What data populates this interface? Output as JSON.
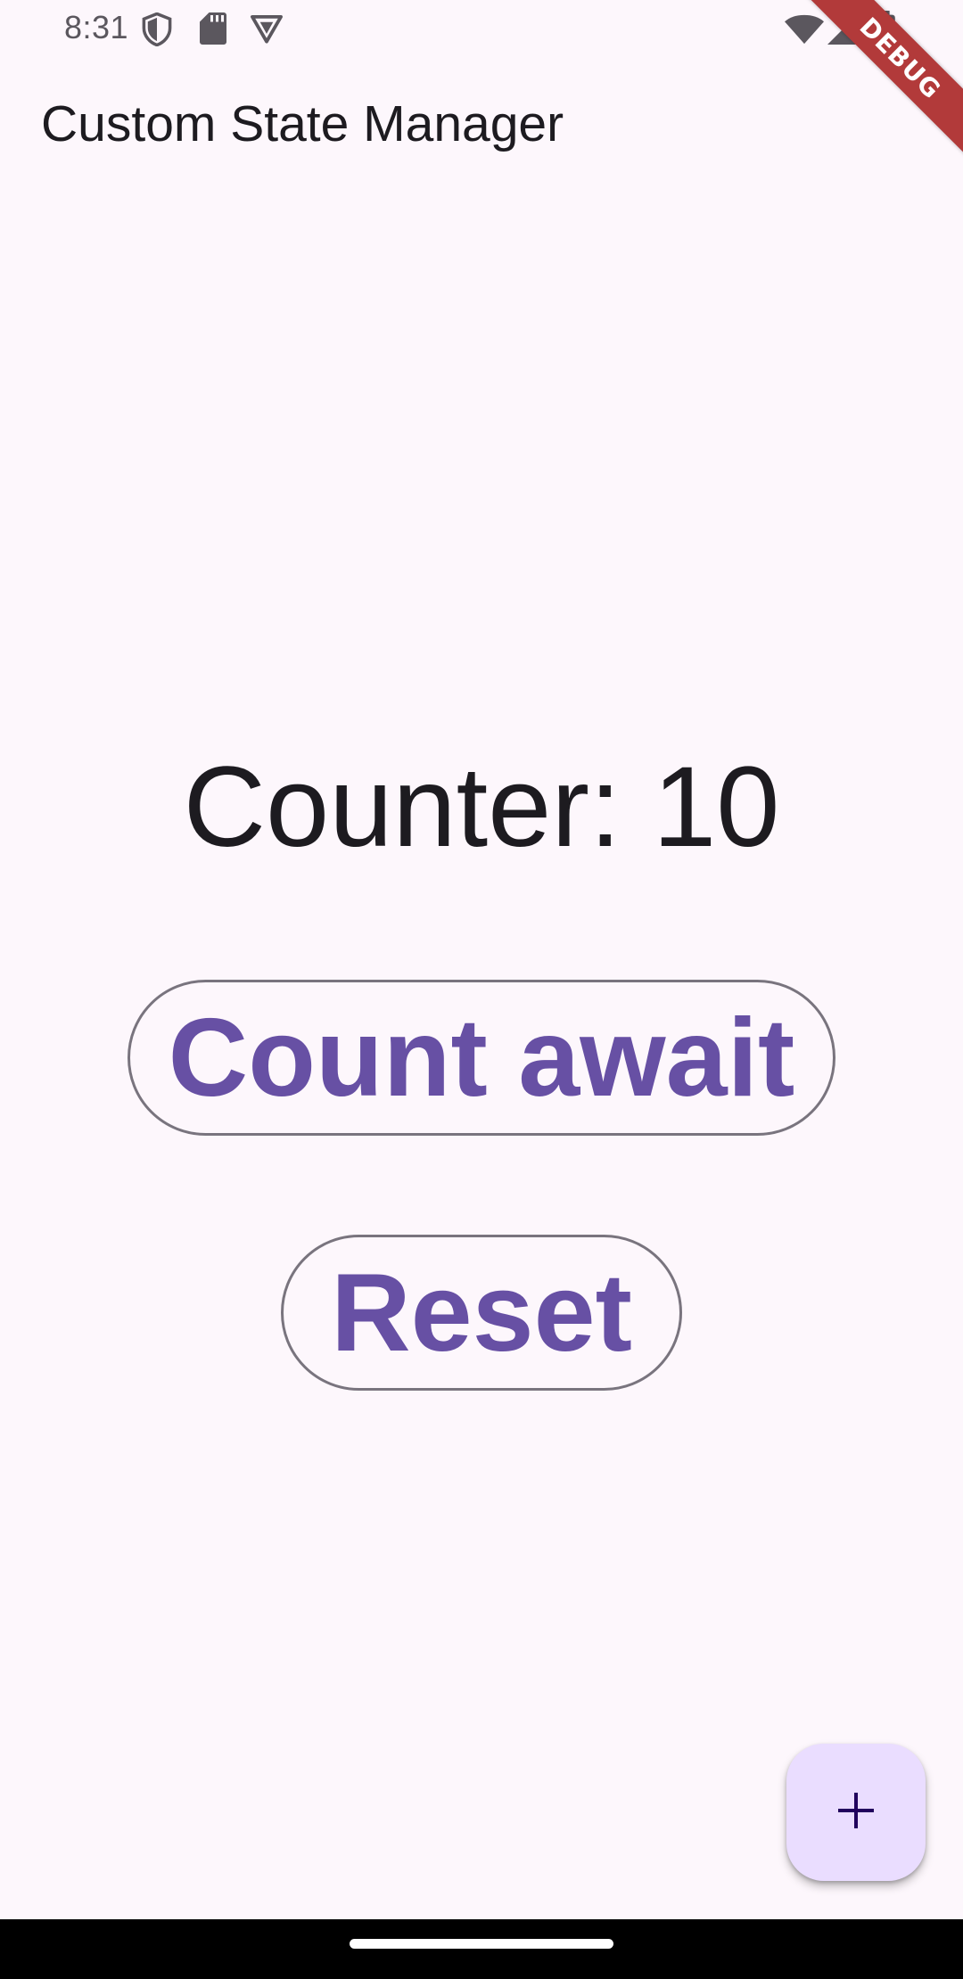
{
  "status_bar": {
    "time": "8:31",
    "icons_left": [
      "shield-icon",
      "sd-card-icon",
      "vpn-icon"
    ],
    "icons_right": [
      "wifi-icon",
      "signal-icon",
      "battery-icon"
    ]
  },
  "app_bar": {
    "title": "Custom State Manager"
  },
  "debug_banner": {
    "label": "DEBUG"
  },
  "main": {
    "counter_text": "Counter: 10",
    "count_button_label": "Count await",
    "reset_button_label": "Reset"
  },
  "fab": {
    "icon": "plus-icon"
  },
  "colors": {
    "background": "#fdf7fc",
    "primary": "#6750a4",
    "outline": "#79747e",
    "fab_bg": "#eaddff",
    "debug_banner": "#b23a3a"
  }
}
